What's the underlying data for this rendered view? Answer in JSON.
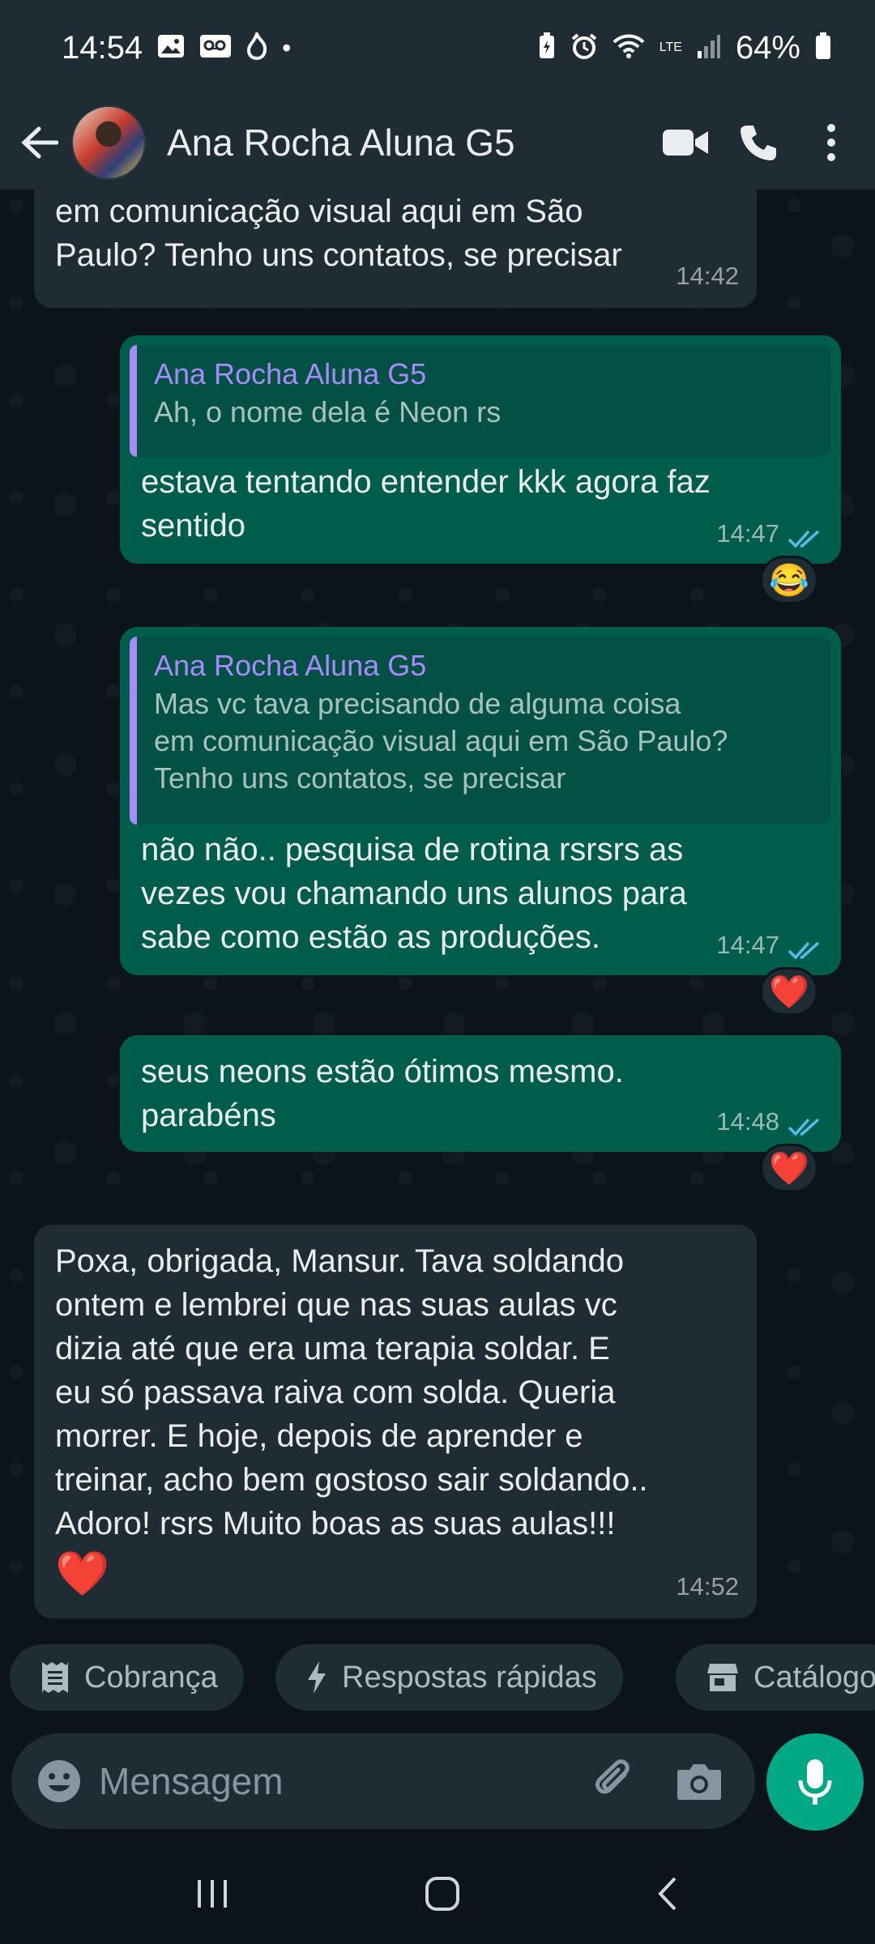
{
  "status_bar": {
    "time": "14:54",
    "battery": "64%",
    "network": "LTE"
  },
  "header": {
    "contact_name": "Ana Rocha Aluna G5"
  },
  "colors": {
    "accent": "#00a884",
    "outgoing_bubble": "#005c4b",
    "incoming_bubble": "#202c33",
    "quote_author": "#a78bfa"
  },
  "messages": [
    {
      "direction": "in",
      "text_lines": [
        "em comunicação visual aqui em São",
        "Paulo? Tenho uns contatos, se precisar"
      ],
      "time": "14:42"
    },
    {
      "direction": "out",
      "quote": {
        "author": "Ana Rocha Aluna G5",
        "text": "Ah, o nome dela é Neon rs"
      },
      "text_lines": [
        "estava tentando entender kkk agora faz",
        "sentido"
      ],
      "time": "14:47",
      "reaction": "😂"
    },
    {
      "direction": "out",
      "quote": {
        "author": "Ana Rocha Aluna G5",
        "text_lines": [
          "Mas vc tava precisando de alguma coisa",
          "em comunicação visual aqui em São Paulo?",
          "Tenho uns contatos, se precisar"
        ]
      },
      "text_lines": [
        "não não.. pesquisa de rotina rsrsrs as",
        "vezes vou chamando uns alunos para",
        "sabe como estão as produções."
      ],
      "time": "14:47",
      "reaction": "❤️"
    },
    {
      "direction": "out",
      "text_lines": [
        "seus neons estão ótimos mesmo.",
        "parabéns"
      ],
      "time": "14:48",
      "reaction": "❤️"
    },
    {
      "direction": "in",
      "text_lines": [
        "Poxa, obrigada, Mansur. Tava soldando",
        "ontem e lembrei que nas suas aulas vc",
        "dizia até que era uma terapia soldar. E",
        "eu só passava raiva com solda. Queria",
        "morrer. E hoje, depois de aprender e",
        "treinar, acho bem gostoso sair soldando..",
        "Adoro! rsrs Muito boas as suas aulas!!!"
      ],
      "emoji": "❤️",
      "time": "14:52"
    }
  ],
  "quick_replies": [
    "Cobrança",
    "Respostas rápidas",
    "Catálogo"
  ],
  "composer": {
    "placeholder": "Mensagem"
  }
}
